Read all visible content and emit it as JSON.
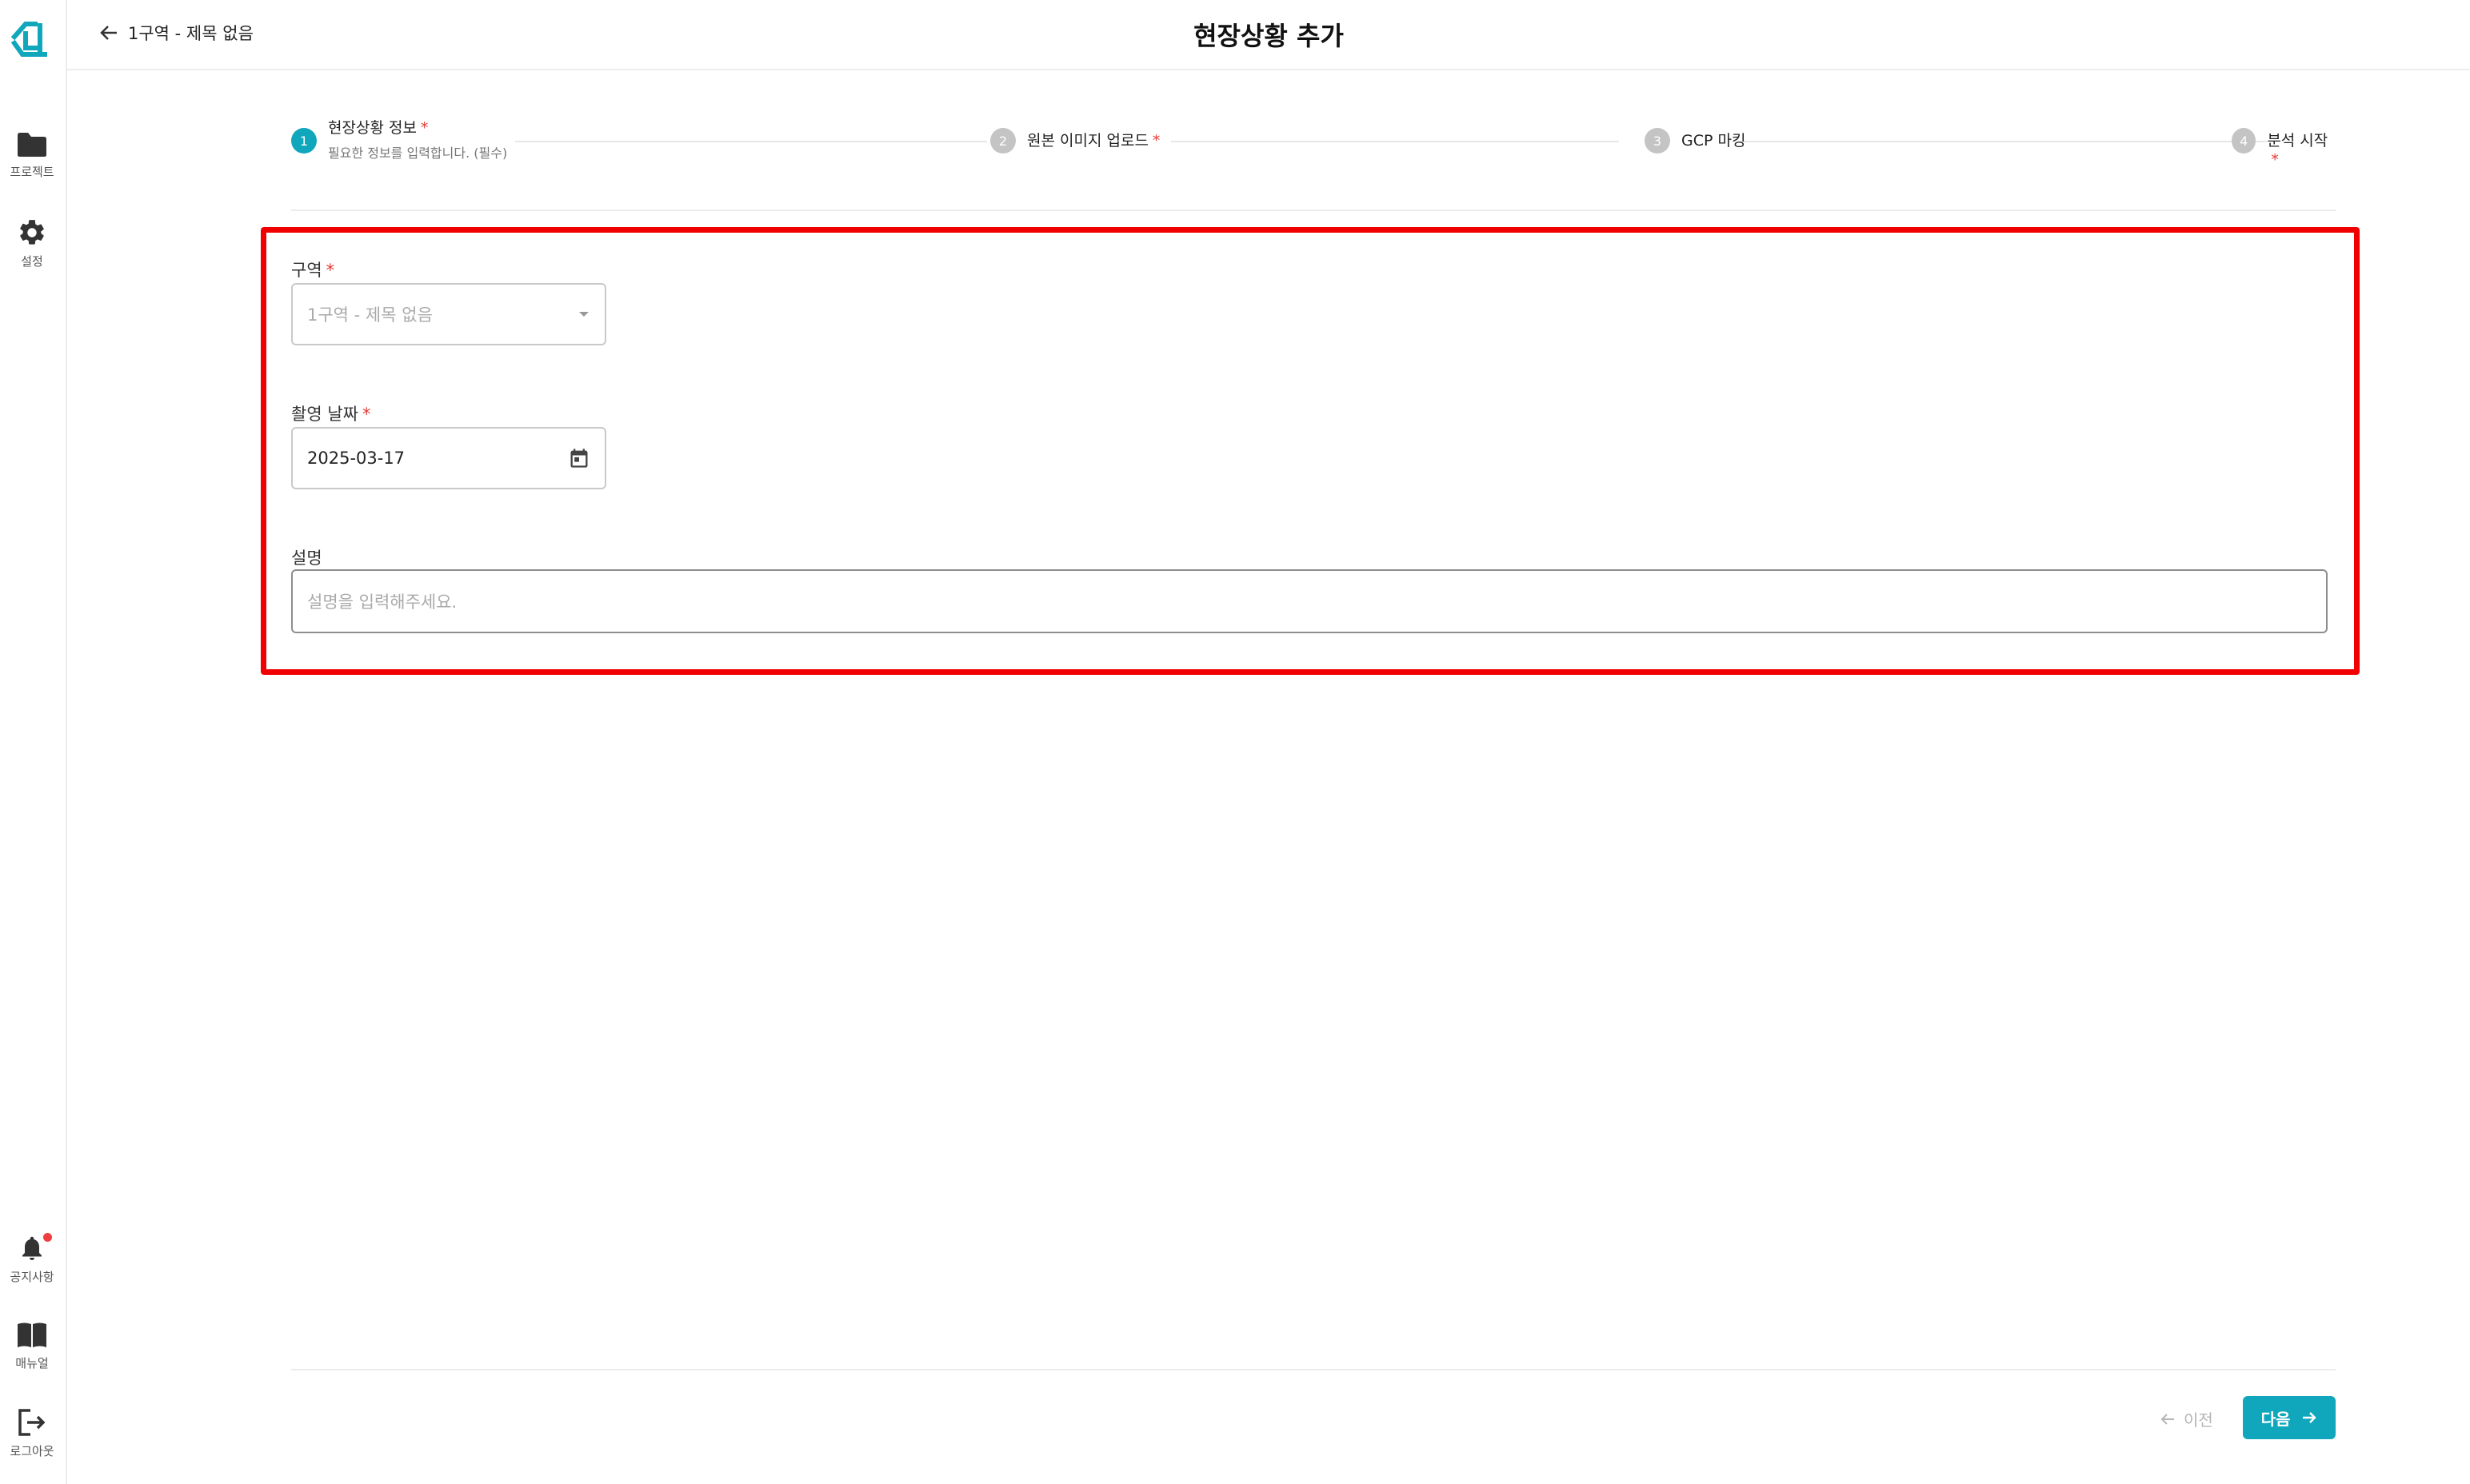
{
  "sidebar": {
    "items": [
      {
        "label": "프로젝트",
        "icon": "folder-icon"
      },
      {
        "label": "설정",
        "icon": "gear-icon"
      }
    ],
    "bottom_items": [
      {
        "label": "공지사항",
        "icon": "bell-icon"
      },
      {
        "label": "매뉴얼",
        "icon": "book-icon"
      },
      {
        "label": "로그아웃",
        "icon": "logout-icon"
      }
    ]
  },
  "header": {
    "back_label": "1구역 - 제목 없음",
    "title": "현장상황 추가"
  },
  "stepper": {
    "steps": [
      {
        "number": "1",
        "label": "현장상황 정보",
        "required_mark": "*",
        "sub": "필요한 정보를 입력합니다. (필수)"
      },
      {
        "number": "2",
        "label": "원본 이미지 업로드",
        "required_mark": "*"
      },
      {
        "number": "3",
        "label": "GCP 마킹",
        "required_mark": ""
      },
      {
        "number": "4",
        "label": "분석 시작",
        "required_mark": "*"
      }
    ]
  },
  "form": {
    "zone": {
      "label": "구역",
      "required_mark": "*",
      "value": "1구역 - 제목 없음"
    },
    "date": {
      "label": "촬영 날짜",
      "required_mark": "*",
      "value": "2025-03-17"
    },
    "description": {
      "label": "설명",
      "placeholder": "설명을 입력해주세요."
    }
  },
  "footer": {
    "prev_label": "이전",
    "next_label": "다음"
  },
  "colors": {
    "accent": "#10a7bd",
    "highlight": "#f00000",
    "required": "#e53935",
    "notification_dot": "#f03e3e"
  }
}
